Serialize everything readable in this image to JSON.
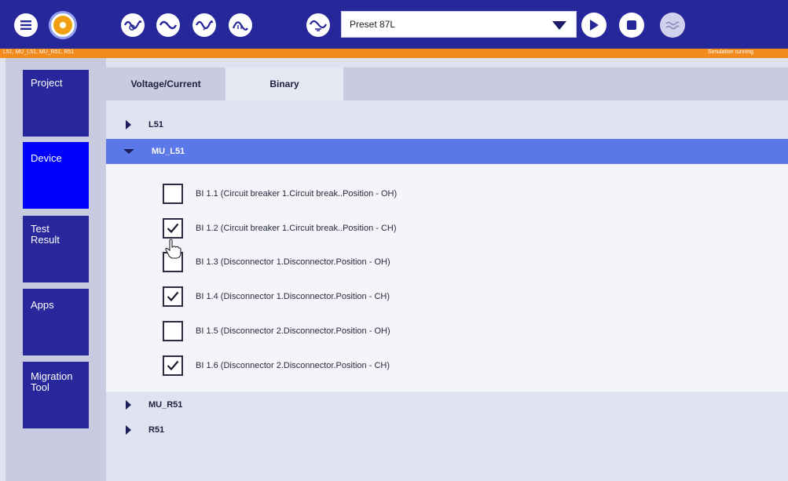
{
  "toolbar": {
    "preset_value": "Preset 87L"
  },
  "status": {
    "left_text": "L51, MU_L51, MU_R51, R51",
    "right_text": "Simulation running"
  },
  "nav": {
    "items": [
      {
        "label": "Project",
        "active": false
      },
      {
        "label": "Device",
        "active": true
      },
      {
        "label": "Test Result",
        "line1": "Test",
        "line2": "Result",
        "active": false
      },
      {
        "label": "Apps",
        "active": false
      },
      {
        "label": "Migration Tool",
        "line1": "Migration",
        "line2": "Tool",
        "active": false
      }
    ]
  },
  "tabs": [
    {
      "label": "Voltage/Current",
      "active": false
    },
    {
      "label": "Binary",
      "active": true
    }
  ],
  "groups": [
    {
      "label": "L51",
      "expanded": false
    },
    {
      "label": "MU_L51",
      "expanded": true
    },
    {
      "label": "MU_R51",
      "expanded": false
    },
    {
      "label": "R51",
      "expanded": false
    }
  ],
  "binary_inputs": [
    {
      "label": "BI 1.1 (Circuit breaker 1.Circuit break..Position - OH)",
      "checked": false
    },
    {
      "label": "BI 1.2 (Circuit breaker 1.Circuit break..Position - CH)",
      "checked": true
    },
    {
      "label": "BI 1.3 (Disconnector 1.Disconnector.Position - OH)",
      "checked": false
    },
    {
      "label": "BI 1.4 (Disconnector 1.Disconnector.Position - CH)",
      "checked": true
    },
    {
      "label": "BI 1.5 (Disconnector 2.Disconnector.Position - OH)",
      "checked": false
    },
    {
      "label": "BI 1.6 (Disconnector 2.Disconnector.Position - CH)",
      "checked": true
    }
  ],
  "icons": {
    "menu": "menu-icon",
    "logo": "app-logo-icon",
    "signal_1": "signal-gen-icon",
    "signal_2": "sine-wave-icon",
    "signal_3": "signal-fault-icon",
    "signal_4": "signal-half-icon",
    "signal_5": "signal-earth-icon",
    "play": "play-icon",
    "stop": "stop-icon",
    "wave": "wave-icon"
  },
  "colors": {
    "toolbar_bg": "#26289a",
    "status_bar": "#f28a1c",
    "nav_button": "#28289c",
    "nav_active": "#0000ff",
    "group_selected": "#5a78e8"
  }
}
